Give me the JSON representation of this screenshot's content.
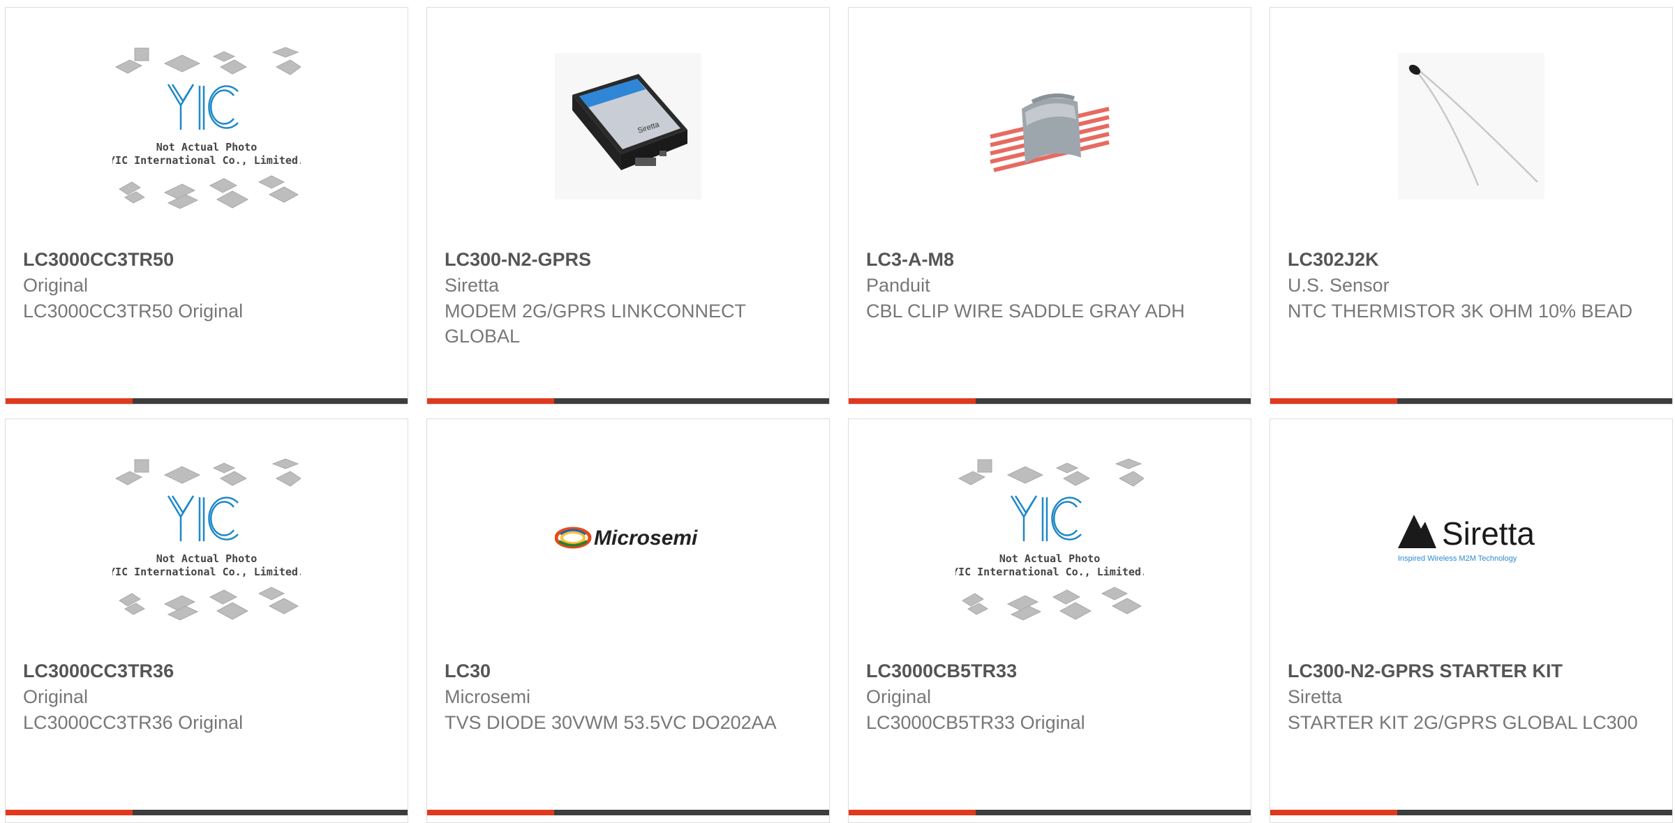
{
  "colors": {
    "accent": "#e0391e",
    "bar": "#3d3d3d",
    "text_dark": "#555555",
    "text_light": "#777777"
  },
  "placeholder": {
    "brand": "YIC",
    "line1": "Not Actual Photo",
    "line2": "YIC International Co., Limited."
  },
  "products": [
    {
      "part": "LC3000CC3TR50",
      "manufacturer": "Original",
      "description": "LC3000CC3TR50 Original",
      "image": "yic-placeholder-image"
    },
    {
      "part": "LC300-N2-GPRS",
      "manufacturer": "Siretta",
      "description": "MODEM 2G/GPRS LINKCONNECT GLOBAL",
      "image": "modem-device-image",
      "image_text": "Siretta"
    },
    {
      "part": "LC3-A-M8",
      "manufacturer": "Panduit",
      "description": "CBL CLIP WIRE SADDLE GRAY ADH",
      "image": "cable-clip-image"
    },
    {
      "part": "LC302J2K",
      "manufacturer": "U.S. Sensor",
      "description": "NTC THERMISTOR 3K OHM 10% BEAD",
      "image": "thermistor-image"
    },
    {
      "part": "LC3000CC3TR36",
      "manufacturer": "Original",
      "description": "LC3000CC3TR36 Original",
      "image": "yic-placeholder-image"
    },
    {
      "part": "LC30",
      "manufacturer": "Microsemi",
      "description": "TVS DIODE 30VWM 53.5VC DO202AA",
      "image": "microsemi-logo",
      "image_text": "Microsemi"
    },
    {
      "part": "LC3000CB5TR33",
      "manufacturer": "Original",
      "description": "LC3000CB5TR33 Original",
      "image": "yic-placeholder-image"
    },
    {
      "part": "LC300-N2-GPRS STARTER KIT",
      "manufacturer": "Siretta",
      "description": "STARTER KIT 2G/GPRS GLOBAL LC300",
      "image": "siretta-logo",
      "image_text": "Siretta",
      "image_tagline": "Inspired Wireless M2M Technology"
    }
  ]
}
